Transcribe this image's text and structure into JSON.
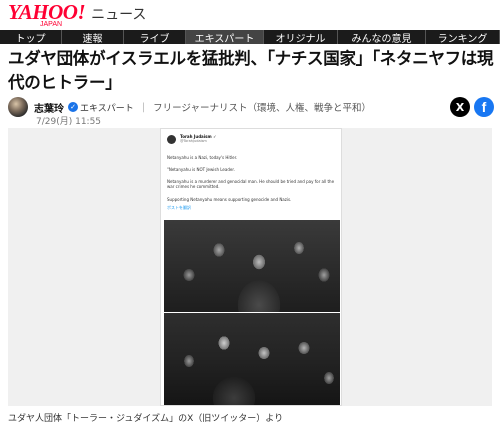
{
  "header": {
    "logo_main": "YAHOO!",
    "logo_sub": "JAPAN",
    "section": "ニュース"
  },
  "nav": {
    "tabs": [
      {
        "label": "トップ",
        "active": false
      },
      {
        "label": "速報",
        "active": false
      },
      {
        "label": "ライブ",
        "active": false
      },
      {
        "label": "エキスパート",
        "active": true
      },
      {
        "label": "オリジナル",
        "active": false
      },
      {
        "label": "みんなの意見",
        "active": false
      },
      {
        "label": "ランキング",
        "active": false
      }
    ]
  },
  "article": {
    "title": "ユダヤ団体がイスラエルを猛批判、「ナチス国家」「ネタニヤフは現代のヒトラー」",
    "author": {
      "name": "志葉玲",
      "badge": "エキスパート",
      "description": "フリージャーナリスト（環境、人権、戦争と平和）"
    },
    "date": "7/29(月) 11:55",
    "share": {
      "x_label": "X",
      "facebook_label": "f"
    },
    "image": {
      "tweet": {
        "name": "Torah Judaism ✓",
        "handle": "@TorahJudaism",
        "line1": "Netanyahu is a Nazi, today's Hitler.",
        "line2": "\"Netanyahu is NOT Jewish Leader.",
        "line3": "Netanyahu is a murderer and genocidal man. He should be tried and pay for all the war crimes he committed.",
        "line4": "Supporting Netanyahu means supporting genocide and Nazis.",
        "link": "ポストを翻訳"
      }
    },
    "caption": "ユダヤ人団体「トーラー・ジュダイズム」のX（旧ツイッター）より"
  },
  "colors": {
    "brand": "#ff0033",
    "nav_bg": "#1b1b1b",
    "badge": "#1a73e8",
    "facebook": "#1877f2"
  }
}
